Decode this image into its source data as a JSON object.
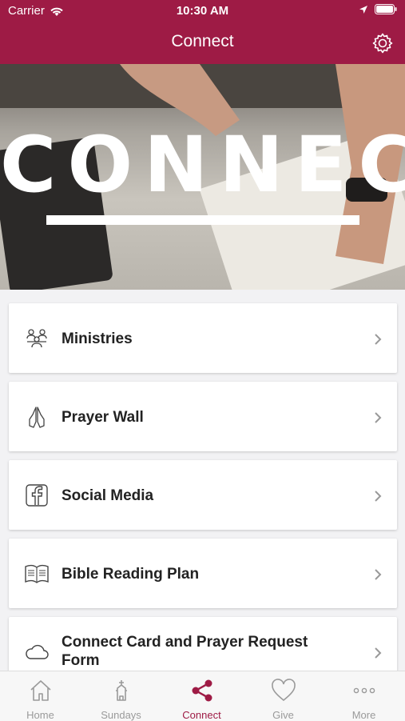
{
  "status": {
    "carrier": "Carrier",
    "time": "10:30 AM"
  },
  "header": {
    "title": "Connect"
  },
  "hero": {
    "word": "CONNECT"
  },
  "items": [
    {
      "label": "Ministries",
      "icon": "people-icon"
    },
    {
      "label": "Prayer Wall",
      "icon": "praying-hands-icon"
    },
    {
      "label": "Social Media",
      "icon": "facebook-icon"
    },
    {
      "label": "Bible Reading Plan",
      "icon": "book-icon"
    },
    {
      "label": "Connect Card and Prayer Request Form",
      "icon": "cloud-icon"
    }
  ],
  "tabs": [
    {
      "label": "Home",
      "icon": "home-icon"
    },
    {
      "label": "Sundays",
      "icon": "church-icon"
    },
    {
      "label": "Connect",
      "icon": "share-icon",
      "active": true
    },
    {
      "label": "Give",
      "icon": "heart-icon"
    },
    {
      "label": "More",
      "icon": "more-icon"
    }
  ],
  "colors": {
    "brand": "#9e1b45",
    "tab_inactive": "#9a9a9a"
  }
}
